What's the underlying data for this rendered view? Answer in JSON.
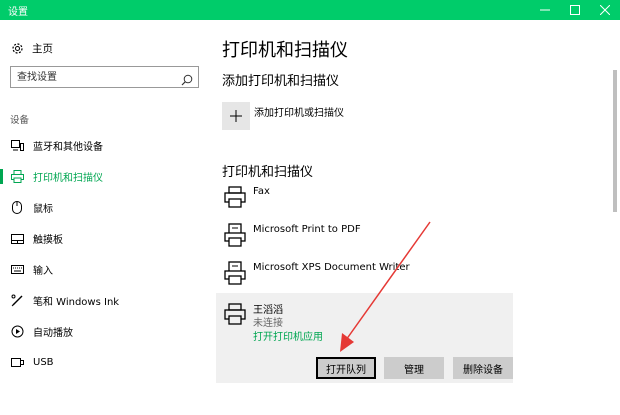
{
  "window": {
    "title": "设置",
    "controls": [
      "minimize",
      "maximize",
      "close"
    ]
  },
  "sidebar": {
    "home_label": "主页",
    "search_placeholder": "查找设置",
    "section_label": "设备",
    "items": [
      {
        "label": "蓝牙和其他设备",
        "icon": "bluetooth-devices-icon",
        "active": false
      },
      {
        "label": "打印机和扫描仪",
        "icon": "printer-icon",
        "active": true
      },
      {
        "label": "鼠标",
        "icon": "mouse-icon",
        "active": false
      },
      {
        "label": "触摸板",
        "icon": "touchpad-icon",
        "active": false
      },
      {
        "label": "输入",
        "icon": "keyboard-icon",
        "active": false
      },
      {
        "label": "笔和 Windows Ink",
        "icon": "pen-icon",
        "active": false
      },
      {
        "label": "自动播放",
        "icon": "autoplay-icon",
        "active": false
      },
      {
        "label": "USB",
        "icon": "usb-icon",
        "active": false
      }
    ]
  },
  "main": {
    "title": "打印机和扫描仪",
    "add_section_title": "添加打印机和扫描仪",
    "add_button_label": "添加打印机或扫描仪",
    "list_section_title": "打印机和扫描仪",
    "printers": [
      {
        "name": "Fax",
        "icon": "fax-printer-icon"
      },
      {
        "name": "Microsoft Print to PDF",
        "icon": "pdf-printer-icon"
      },
      {
        "name": "Microsoft XPS Document Writer",
        "icon": "xps-printer-icon"
      }
    ],
    "selected_printer": {
      "name": "王滔滔",
      "status": "未连接",
      "link": "打开打印机应用",
      "buttons": {
        "open_queue": "打开队列",
        "manage": "管理",
        "remove": "删除设备"
      }
    }
  },
  "colors": {
    "titlebar": "#00cc6a",
    "accent": "#00a651",
    "annotation_arrow": "#e53935",
    "selected_bg": "#f0f0f0",
    "button_bg": "#cccccc"
  }
}
